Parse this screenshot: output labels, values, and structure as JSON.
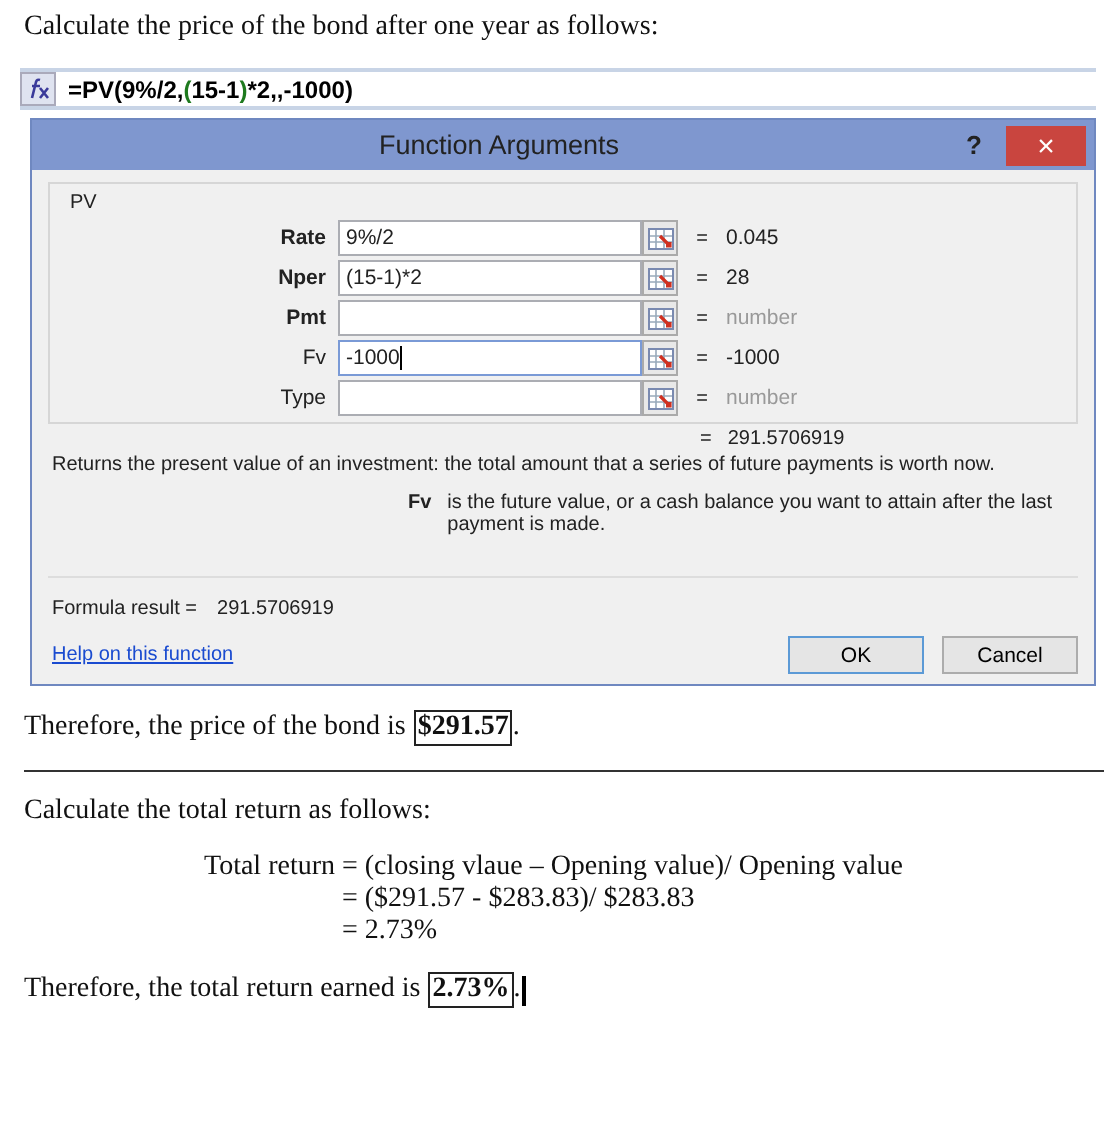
{
  "intro": "Calculate the price of the bond after one year as follows:",
  "formula_bar": {
    "segments": [
      {
        "text": "=PV(9%/2,",
        "color": "#000000"
      },
      {
        "text": "(",
        "color": "#1e7a1e"
      },
      {
        "text": "15-1",
        "color": "#000000"
      },
      {
        "text": ")",
        "color": "#1e7a1e"
      },
      {
        "text": "*2,,-1000)",
        "color": "#000000"
      }
    ]
  },
  "dialog": {
    "title": "Function Arguments",
    "help": "?",
    "close": "×",
    "group": "PV",
    "arguments": [
      {
        "label": "Rate",
        "required": true,
        "value": "9%/2",
        "equals": "=",
        "result": "0.045",
        "focused": false
      },
      {
        "label": "Nper",
        "required": true,
        "value": "(15-1)*2",
        "equals": "=",
        "result": "28",
        "focused": false
      },
      {
        "label": "Pmt",
        "required": true,
        "equals": "=",
        "result": "number",
        "focused": false
      },
      {
        "label": "Fv",
        "required": false,
        "value": "-1000",
        "equals": "=",
        "result": "-1000",
        "focused": true
      },
      {
        "label": "Type",
        "required": false,
        "equals": "=",
        "result": "number",
        "focused": false
      }
    ],
    "total_equals": "=",
    "total": "291.5706919",
    "description": "Returns the present value of an investment: the total amount that a series of future payments is worth now.",
    "arg_name": "Fv",
    "arg_help": "is the future value, or a cash balance you want to attain after the last payment is made.",
    "formula_result_label": "Formula result =",
    "formula_result": "291.5706919",
    "help_link": "Help on this function",
    "buttons": [
      {
        "label": "OK",
        "default": true
      },
      {
        "label": "Cancel",
        "default": false
      }
    ]
  },
  "answer_1": {
    "prefix": "Therefore, the price of the bond is",
    "answer": "$291.57",
    "suffix": "."
  },
  "section_2": "Calculate the total return as follows:",
  "equation": {
    "lhs": "Total return",
    "lines": [
      "= (closing vlaue – Opening value)/ Opening value",
      "=  ($291.57 - $283.83)/ $283.83",
      "= 2.73%"
    ]
  },
  "answer_2": {
    "prefix": "Therefore, the total return earned is",
    "answer": "2.73%",
    "suffix": ".",
    "cursor": true
  }
}
